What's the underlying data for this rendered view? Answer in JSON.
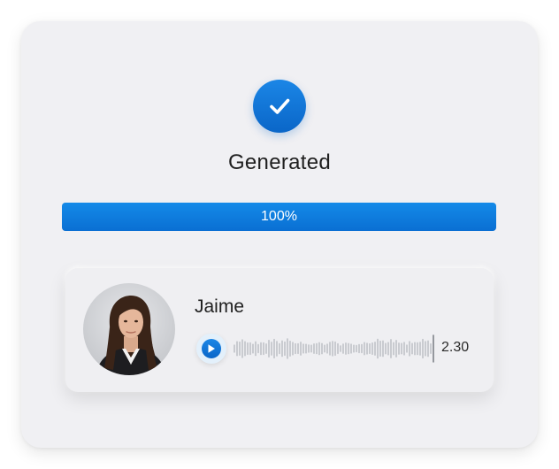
{
  "status": {
    "title": "Generated",
    "icon": "check-circle-icon",
    "accent_color": "#0a6fd3"
  },
  "progress": {
    "label": "100%",
    "value_percent": 100
  },
  "audio": {
    "speaker_name": "Jaime",
    "duration": "2.30",
    "play_icon": "play-icon",
    "avatar_icon": "avatar-photo",
    "waveform_icon": "waveform-icon"
  }
}
